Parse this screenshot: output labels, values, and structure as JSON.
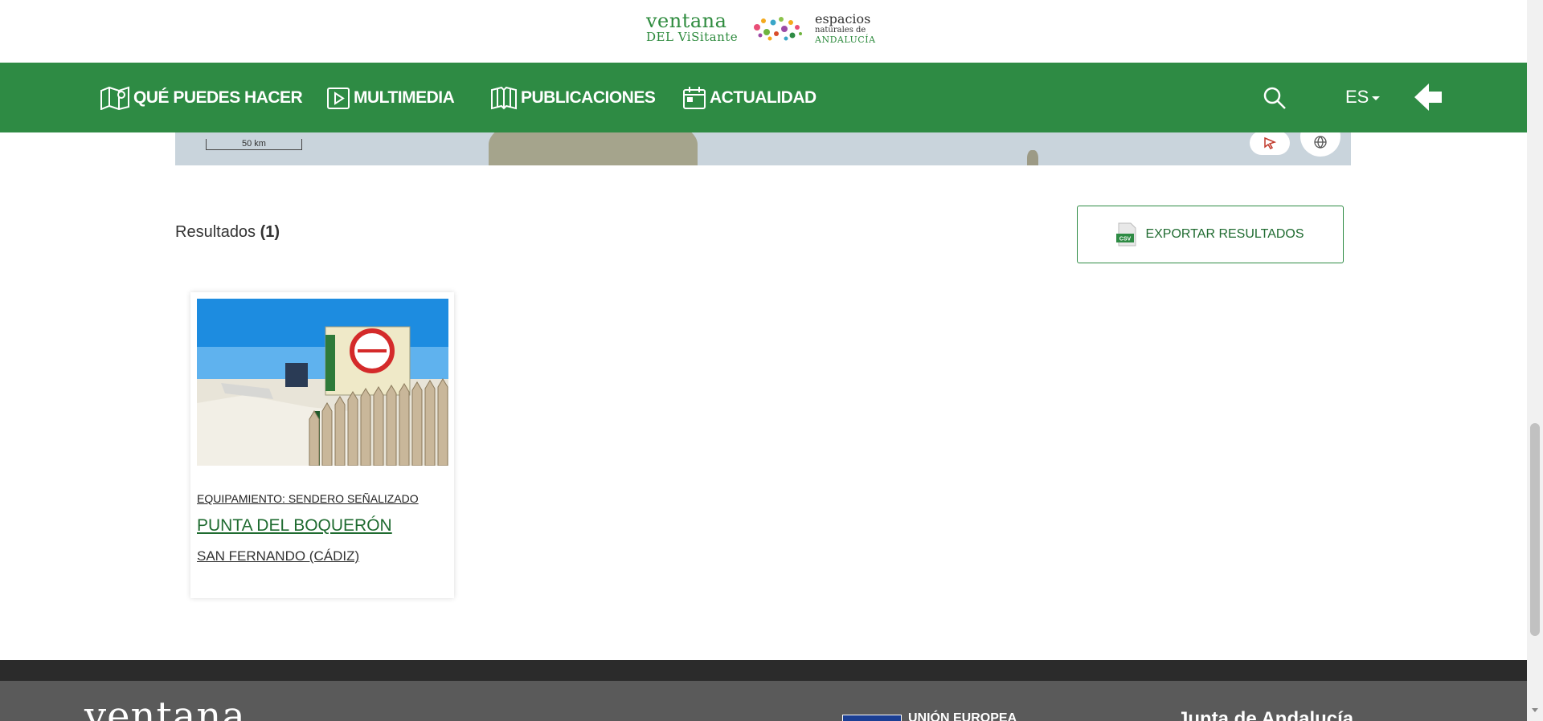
{
  "header": {
    "logo": {
      "line1": "ventana",
      "line2": "DEL ViSitante",
      "partner_line1": "espacios",
      "partner_line2": "naturales de",
      "partner_line3": "ANDALUCÍA"
    }
  },
  "nav": {
    "items": [
      {
        "label": "QUÉ PUEDES HACER",
        "icon": "map-pin-icon"
      },
      {
        "label": "MULTIMEDIA",
        "icon": "play-icon"
      },
      {
        "label": "PUBLICACIONES",
        "icon": "book-icon"
      },
      {
        "label": "ACTUALIDAD",
        "icon": "calendar-icon"
      }
    ],
    "language": "ES",
    "search_icon": "search-icon",
    "back_icon": "arrow-left-icon"
  },
  "map": {
    "scale_label": "50 km"
  },
  "results": {
    "label": "Resultados",
    "count": "(1)",
    "export_label": "EXPORTAR RESULTADOS",
    "export_icon_text": "CSV"
  },
  "cards": [
    {
      "category": "EQUIPAMIENTO: SENDERO SEÑALIZADO",
      "title": "PUNTA DEL BOQUERÓN",
      "location": "SAN FERNANDO (CÁDIZ)"
    }
  ],
  "footer": {
    "logo": "ventana",
    "eu_text": "UNIÓN EUROPEA",
    "right_text": "Junta de Andalucía"
  },
  "colors": {
    "brand_green": "#2e8b44",
    "dark_green": "#1f6b30",
    "footer_dark": "#2b2b2b",
    "footer_grey": "#5a5a5a"
  }
}
